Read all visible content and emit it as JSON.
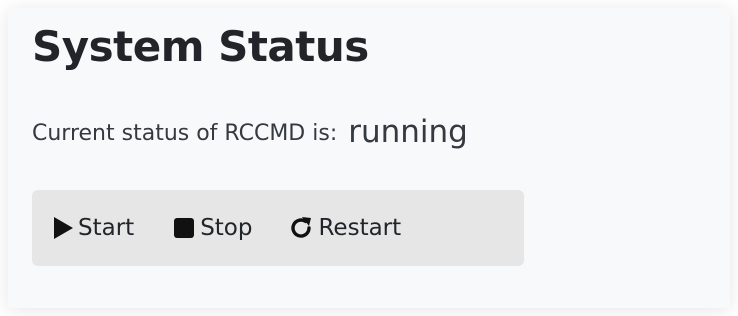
{
  "header": {
    "title": "System Status"
  },
  "status": {
    "label": "Current status of RCCMD is:",
    "value": "running"
  },
  "controls": {
    "start_label": "Start",
    "stop_label": "Stop",
    "restart_label": "Restart",
    "icons": {
      "start": "play-icon",
      "stop": "stop-icon",
      "restart": "restart-icon"
    }
  }
}
